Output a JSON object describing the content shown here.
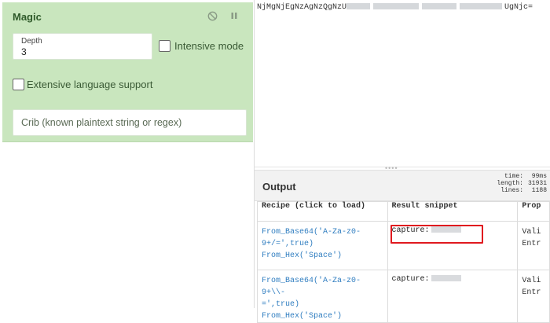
{
  "recipe": {
    "card_title": "Magic",
    "depth_label": "Depth",
    "depth_value": "3",
    "intensive_label": "Intensive mode",
    "extensive_label": "Extensive language support",
    "crib_placeholder": "Crib (known plaintext string or regex)",
    "icons": [
      "disable-icon",
      "pause-icon"
    ]
  },
  "input": {
    "text_start": "NjMgNjEgNzAgNzQgNzU",
    "text_end": "UgNjc="
  },
  "output": {
    "title": "Output",
    "stats": [
      {
        "key": "time:",
        "value": "99ms"
      },
      {
        "key": "length:",
        "value": "31931"
      },
      {
        "key": "lines:",
        "value": "1188"
      }
    ],
    "columns": [
      "Recipe (click to load)",
      "Result snippet",
      "Prop"
    ],
    "rows": [
      {
        "recipe_line1": "From_Base64('A-Za-z0-",
        "recipe_line2": "9+/=',true)",
        "recipe_line3": "From_Hex('Space')",
        "snippet": "capture:",
        "prop_line1": "Vali",
        "prop_line2": "Entr"
      },
      {
        "recipe_line1": "From_Base64('A-Za-z0-9+\\\\-",
        "recipe_line2": "=',true)",
        "recipe_line3": "From_Hex('Space')",
        "snippet": "capture:",
        "prop_line1": "Vali",
        "prop_line2": "Entr"
      }
    ]
  },
  "colors": {
    "card_bg": "#c9e6be",
    "link": "#2f7dc0",
    "highlight": "#e0191f"
  }
}
